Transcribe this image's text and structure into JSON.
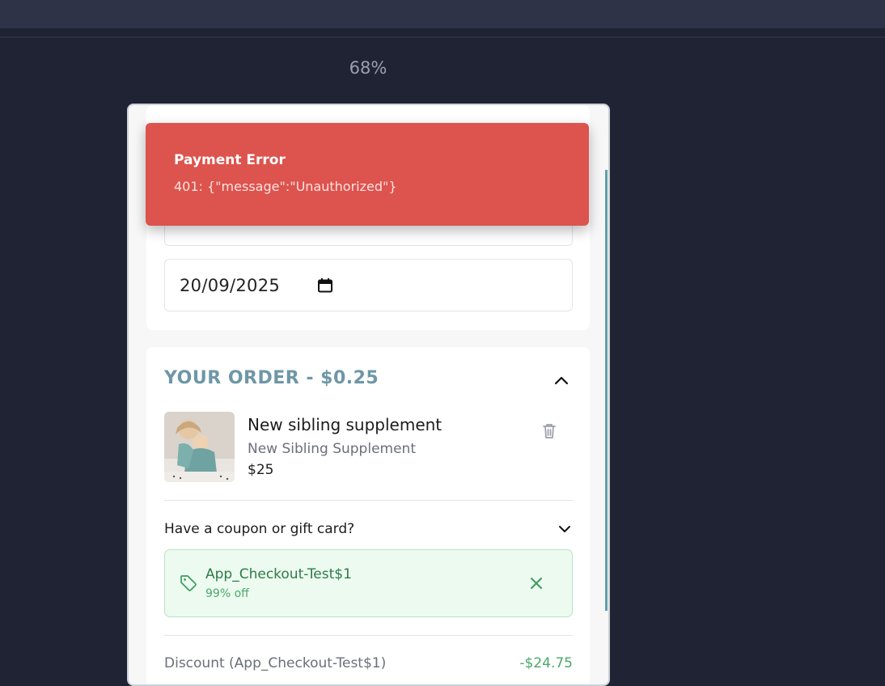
{
  "viewer": {
    "zoom_label": "68%"
  },
  "toast": {
    "title": "Payment Error",
    "message": "401: {\"message\":\"Unauthorized\"}",
    "color": "#dd534d"
  },
  "form": {
    "date_value": "20/09/2025",
    "calendar_icon": "calendar-icon"
  },
  "order": {
    "title": "YOUR ORDER - $0.25",
    "title_color": "#6e97a6",
    "collapse_icon": "chevron-up-icon",
    "items": [
      {
        "name": "New sibling supplement",
        "subtitle": "New Sibling Supplement",
        "price": "$25",
        "thumbnail": "baby-in-teal-onesie-photo",
        "remove_icon": "trash-icon"
      }
    ],
    "coupon": {
      "toggle_label": "Have a coupon or gift card?",
      "applied_code": "App_Checkout-Test$1",
      "applied_discount": "99% off",
      "accent_color": "#2f7a48"
    },
    "discount": {
      "label": "Discount (App_Checkout-Test$1)",
      "value": "-$24.75"
    }
  }
}
